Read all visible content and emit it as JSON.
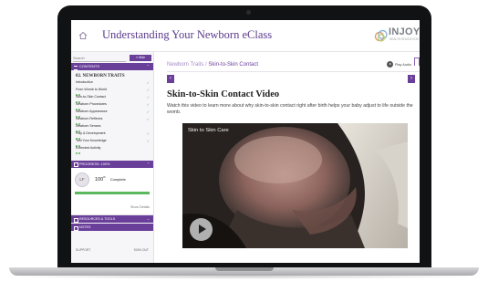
{
  "header": {
    "app_title": "Understanding Your Newborn eClass",
    "brand_name": "INJOY",
    "brand_sub": "HEALTH EDUCATION"
  },
  "sidebar": {
    "search_placeholder": "Search",
    "hide_label": "« Hide",
    "contents_label": "CONTENTS",
    "section_title": "02. NEWBORN TRAITS",
    "items": [
      {
        "label": "Introduction",
        "done": true
      },
      {
        "label": "From Womb to World",
        "done": true
      },
      {
        "label": "Skin-to-Skin Contact",
        "done": true
      },
      {
        "label": "Newborn Procedures",
        "done": true
      },
      {
        "label": "Newborn Appearance",
        "done": true
      },
      {
        "label": "Newborn Reflexes",
        "done": true
      },
      {
        "label": "Newborn Senses",
        "done": false
      },
      {
        "label": "Play & Development",
        "done": true
      },
      {
        "label": "Test Your Knowledge",
        "done": true
      },
      {
        "label": "Extended Activity",
        "done": false
      }
    ],
    "progress_label": "PROGRESS: 100%",
    "avatar_initials": "LF",
    "progress_value": "100",
    "progress_sup": "th",
    "complete_label": "Complete",
    "progress_fraction": 1.0,
    "show_details": "Show Details",
    "resources_label": "RESOURCES & TOOLS",
    "notes_label": "NOTES",
    "support_label": "SUPPORT",
    "signout_label": "SIGN OUT"
  },
  "main": {
    "breadcrumb_parent": "Newborn Traits",
    "breadcrumb_sep": " / ",
    "breadcrumb_current": "Skin-to-Skin Contact",
    "play_audio": "Play Audio",
    "prev_glyph": "‹",
    "next_glyph": "›",
    "heading": "Skin-to-Skin Contact Video",
    "description": "Watch this video to learn more about why skin-to-skin contact right after birth helps your baby adjust to life outside the womb.",
    "video_title": "Skin to Skin Care"
  },
  "colors": {
    "accent": "#6a3f9a",
    "done": "#5bb85d"
  }
}
